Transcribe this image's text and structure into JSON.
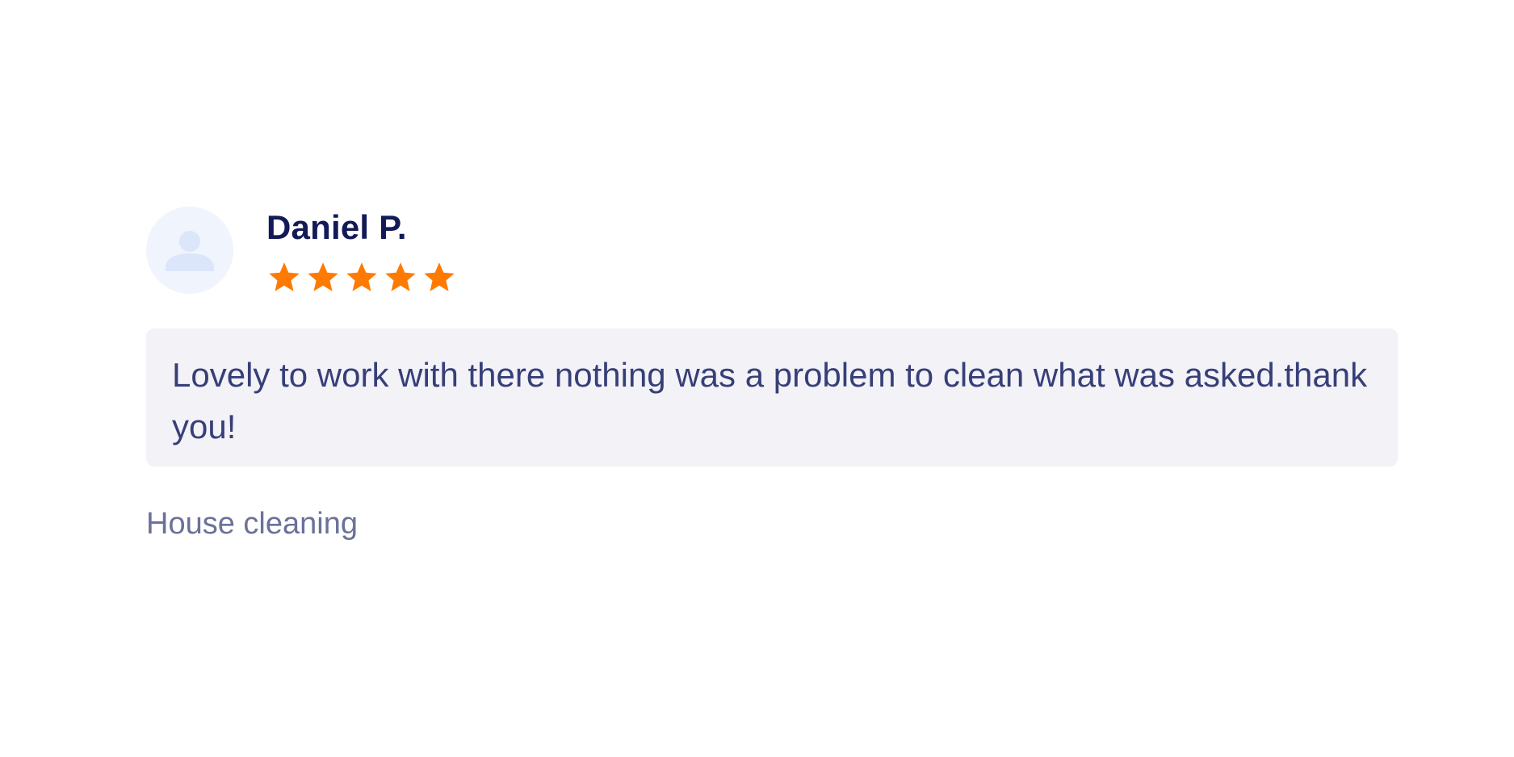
{
  "review": {
    "reviewer_name": "Daniel P.",
    "avatar_icon": "user-placeholder-icon",
    "rating": 5,
    "rating_max": 5,
    "star_icon": "star-icon",
    "star_color": "#ff7a00",
    "text": "Lovely to work with there nothing was a problem to clean what was asked.thank you!",
    "service": "House cleaning"
  },
  "colors": {
    "name": "#121a57",
    "body_text": "#373f78",
    "body_bg": "#f2f2f7",
    "service_text": "#6b7199",
    "avatar_bg": "#f0f4fc",
    "avatar_icon": "#dbe6fb"
  }
}
